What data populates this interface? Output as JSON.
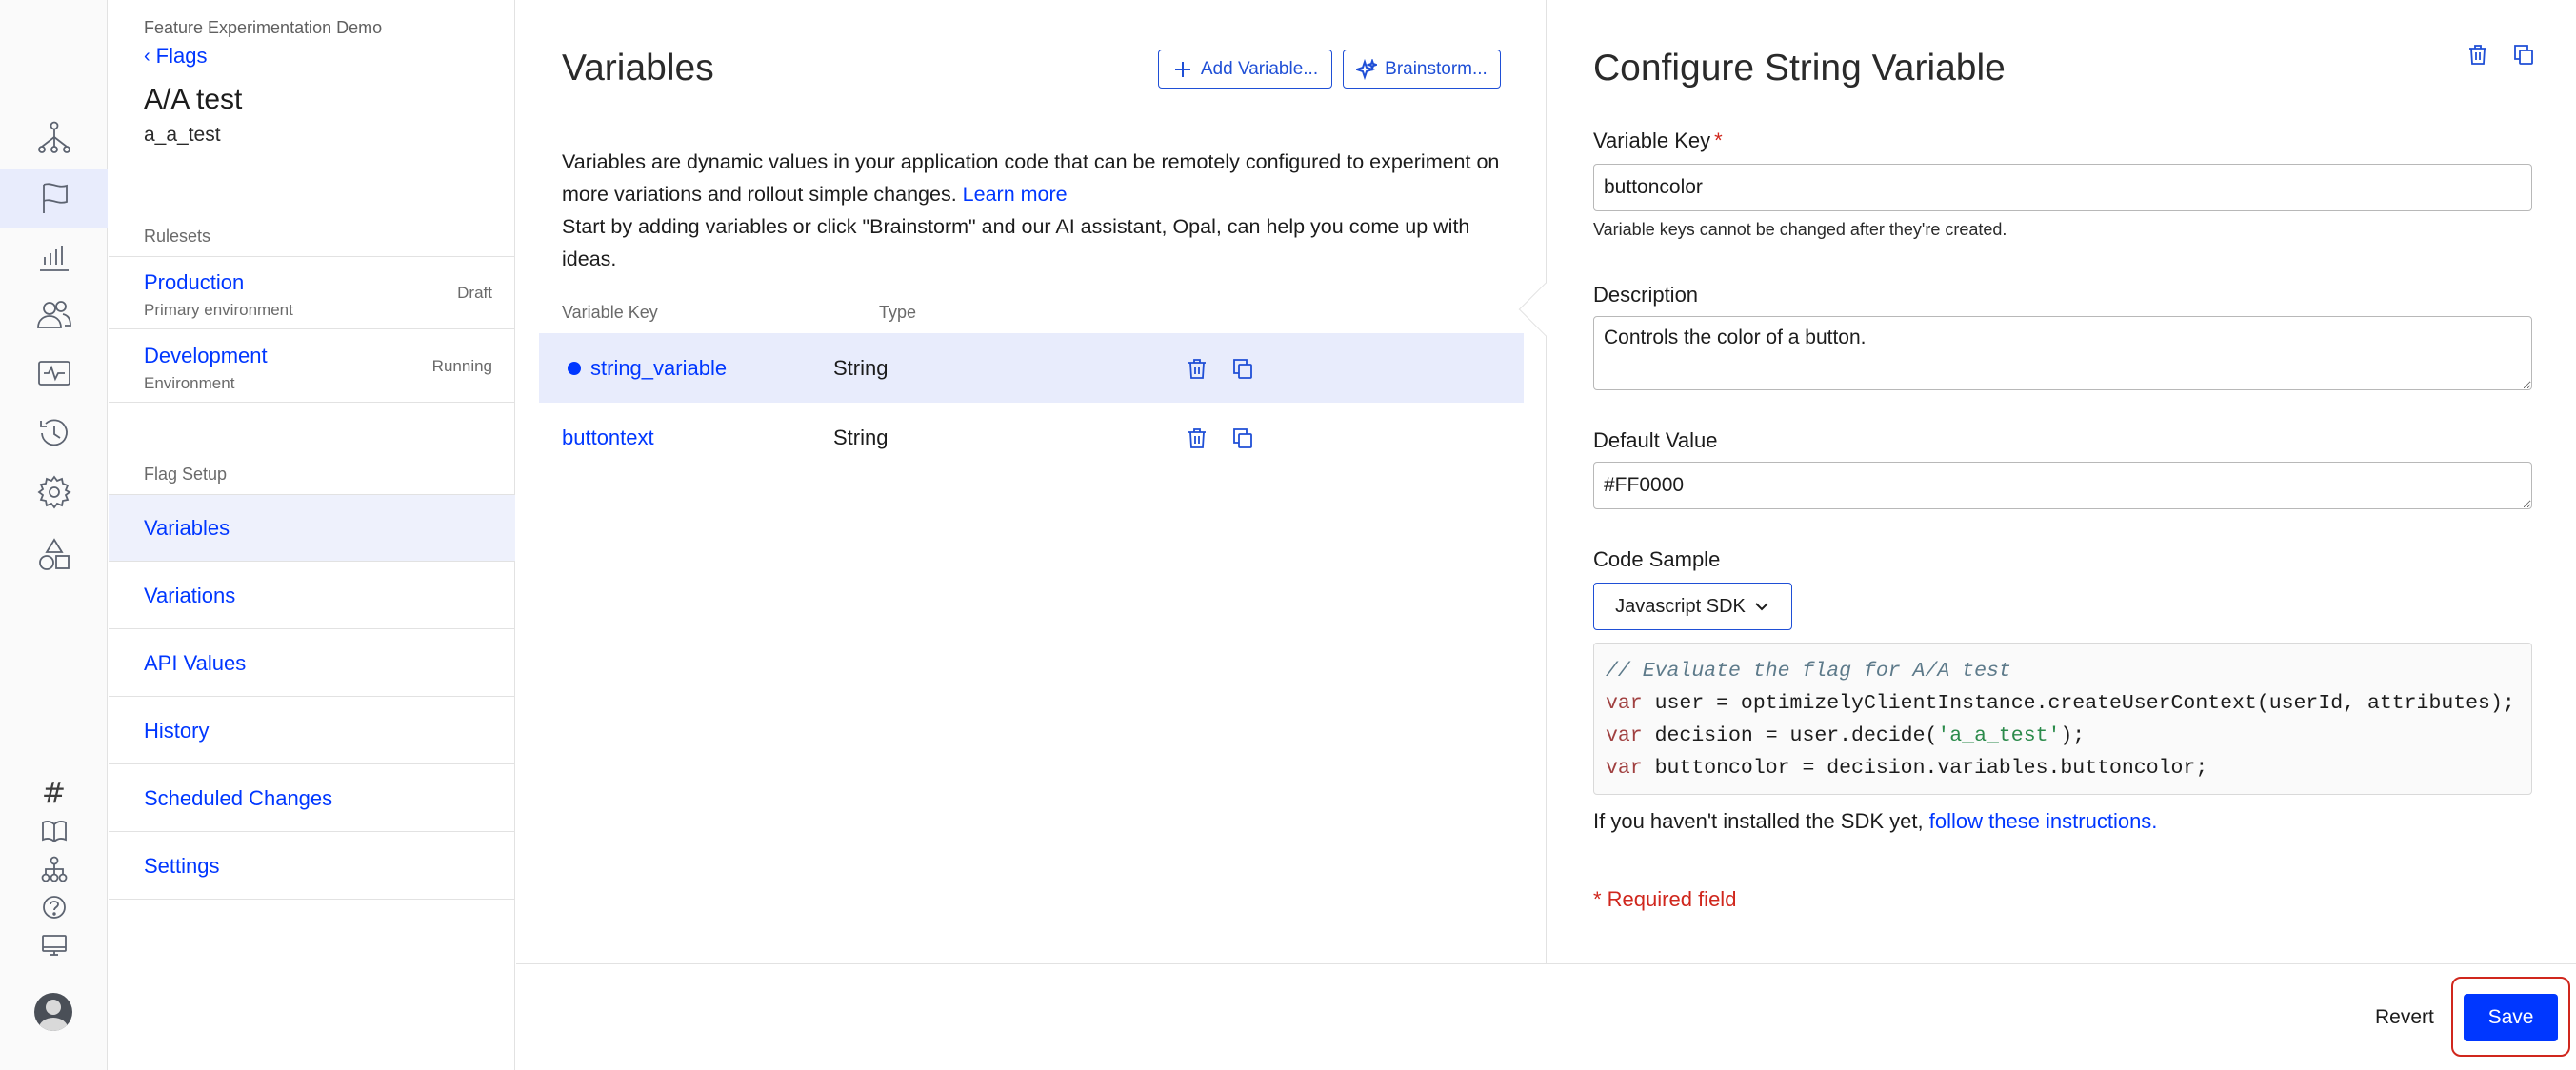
{
  "rail": {
    "icons": [
      "flow-icon",
      "flag-icon",
      "chart-icon",
      "users-icon",
      "monitor-icon",
      "history-icon",
      "gear-icon",
      "shapes-icon",
      "hash-icon",
      "book-icon",
      "hierarchy-icon",
      "help-icon",
      "desktop-icon",
      "avatar"
    ],
    "hash_glyph": "#"
  },
  "flag_nav": {
    "project": "Feature Experimentation Demo",
    "back_label": "Flags",
    "flag_title": "A/A test",
    "flag_key": "a_a_test",
    "rulesets_label": "Rulesets",
    "rulesets": [
      {
        "name": "Production",
        "env": "Primary environment",
        "status": "Draft"
      },
      {
        "name": "Development",
        "env": "Environment",
        "status": "Running"
      }
    ],
    "setup_label": "Flag Setup",
    "setup_items": [
      "Variables",
      "Variations",
      "API Values",
      "History",
      "Scheduled Changes",
      "Settings"
    ]
  },
  "variables": {
    "title": "Variables",
    "add_button": "Add Variable...",
    "brainstorm_button": "Brainstorm...",
    "desc_line1": "Variables are dynamic values in your application code that can be remotely configured to experiment on more variations and rollout simple changes.",
    "learn_more": "Learn more",
    "desc_line2": "Start by adding variables or click \"Brainstorm\" and our AI assistant, Opal, can help you come up with ideas.",
    "col_key": "Variable Key",
    "col_type": "Type",
    "rows": [
      {
        "key": "string_variable",
        "type": "String",
        "selected": true
      },
      {
        "key": "buttontext",
        "type": "String",
        "selected": false
      }
    ]
  },
  "config": {
    "title": "Configure String Variable",
    "key_label": "Variable Key",
    "required_mark": "*",
    "key_value": "buttoncolor",
    "key_helper": "Variable keys cannot be changed after they're created.",
    "description_label": "Description",
    "description_value": "Controls the color of a button.",
    "default_label": "Default Value",
    "default_value": "#FF0000",
    "code_label": "Code Sample",
    "sdk_selected": "Javascript SDK",
    "code": {
      "comment": "// Evaluate the flag for A/A test",
      "kw": "var",
      "line2_rest": " user = optimizelyClientInstance.createUserContext(userId, attributes);",
      "line3_a": " decision = user.decide(",
      "line3_str": "'a_a_test'",
      "line3_b": ");",
      "line4_rest": " buttoncolor = decision.variables.buttoncolor;"
    },
    "sdk_note": "If you haven't installed the SDK yet,",
    "sdk_link": "follow these instructions.",
    "required_note": "* Required field"
  },
  "footer": {
    "revert": "Revert",
    "save": "Save"
  },
  "colors": {
    "accent": "#0037ff",
    "selected_row": "#e8ecfc",
    "required": "#d0271d"
  }
}
